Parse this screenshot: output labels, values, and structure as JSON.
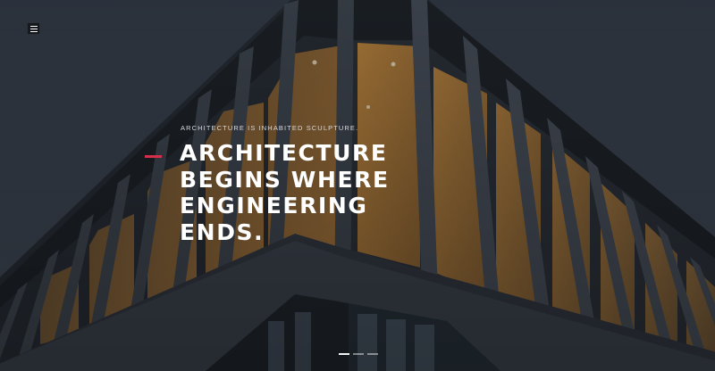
{
  "hero": {
    "tagline": "ARCHITECTURE IS INHABITED SCULPTURE.",
    "headline_lines": [
      "ARCHITECTURE",
      "BEGINS WHERE",
      "ENGINEERING",
      "ENDS."
    ]
  },
  "menu": {
    "icon": "hamburger-menu-icon"
  },
  "slider": {
    "slides": 3,
    "active_index": 0
  },
  "colors": {
    "accent": "#d72f4b",
    "sky": "#3a4350",
    "wood": "#c98e3a"
  }
}
